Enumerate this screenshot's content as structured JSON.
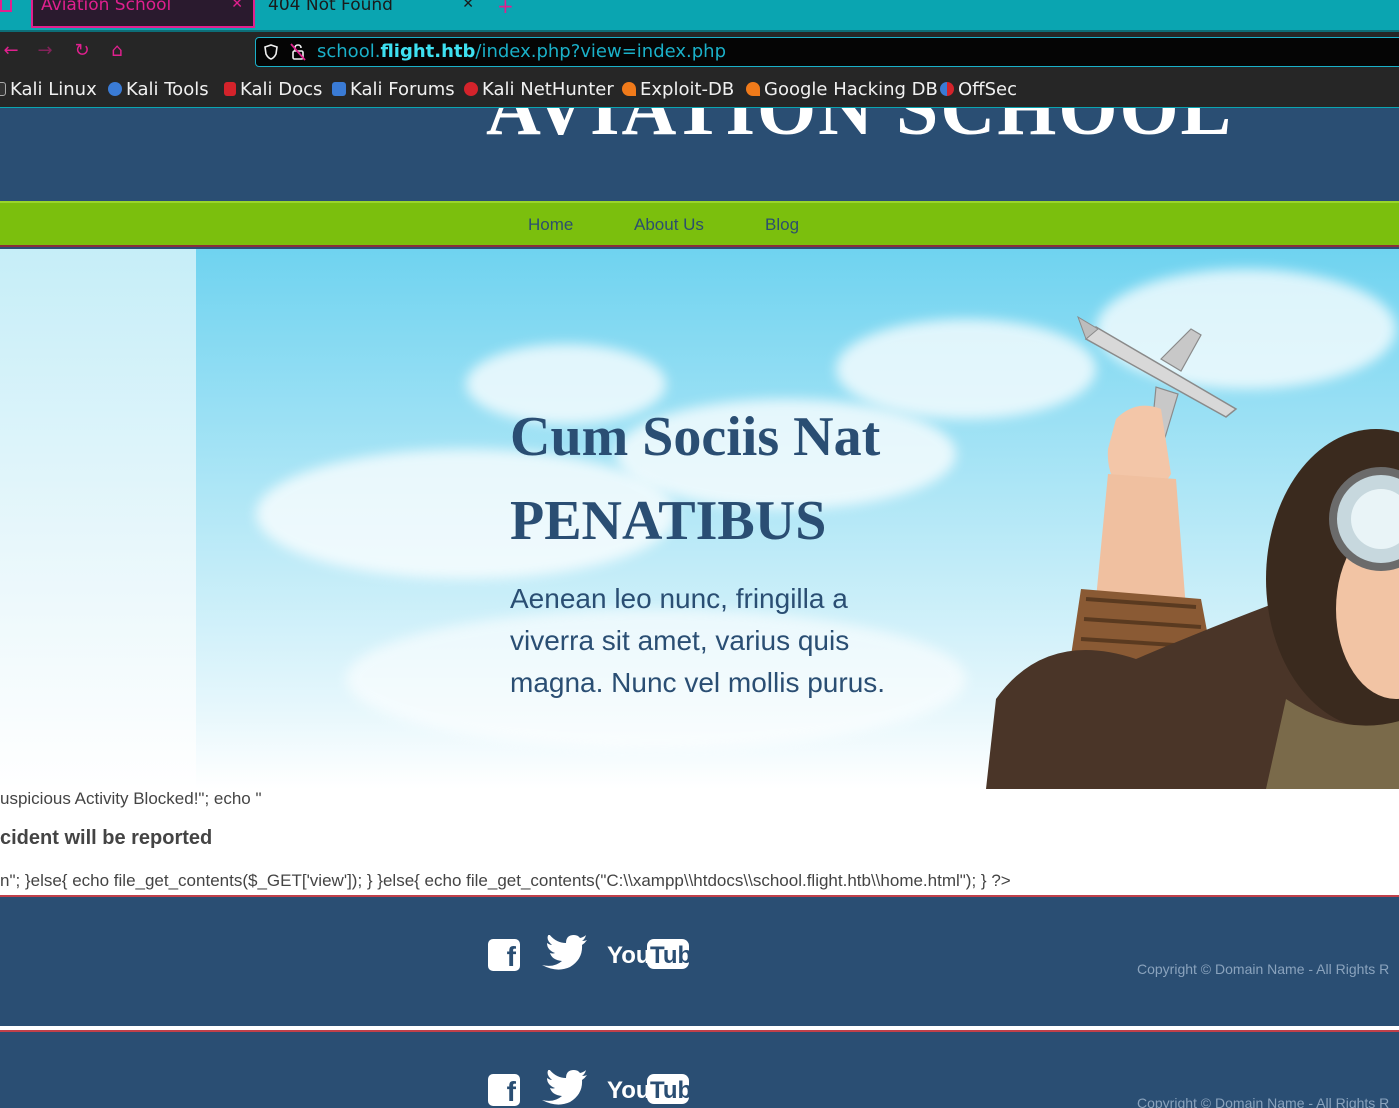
{
  "browser": {
    "tabs": [
      {
        "title": "Aviation School",
        "active": true
      },
      {
        "title": "404 Not Found",
        "active": false
      }
    ],
    "url": {
      "prefix": "school.",
      "host": "flight.htb",
      "path": "/index.php?view=index.php"
    },
    "bookmarks": [
      "Kali Linux",
      "Kali Tools",
      "Kali Docs",
      "Kali Forums",
      "Kali NetHunter",
      "Exploit-DB",
      "Google Hacking DB",
      "OffSec"
    ]
  },
  "site": {
    "logo": "AVIATION SCHOOL",
    "menu": [
      "Home",
      "About Us",
      "Blog"
    ]
  },
  "hero": {
    "title_line1": "Cum Sociis Nat",
    "title_line2": "PENATIBUS",
    "text": "Aenean leo nunc, fringilla a viverra sit amet, varius quis magna. Nunc vel mollis purus."
  },
  "leaked_source": {
    "line1": "uspicious Activity Blocked!\"; echo \"",
    "heading": "cident will be reported",
    "line2": "n\"; }else{ echo file_get_contents($_GET['view']); } }else{ echo file_get_contents(\"C:\\\\xampp\\\\htdocs\\\\school.flight.htb\\\\home.html\"); } ?>"
  },
  "footer": {
    "copyright": "Copyright © Domain Name - All Rights R",
    "social": [
      "facebook",
      "twitter",
      "youtube"
    ],
    "youtube_text_you": "You",
    "youtube_text_tube": "Tube"
  }
}
